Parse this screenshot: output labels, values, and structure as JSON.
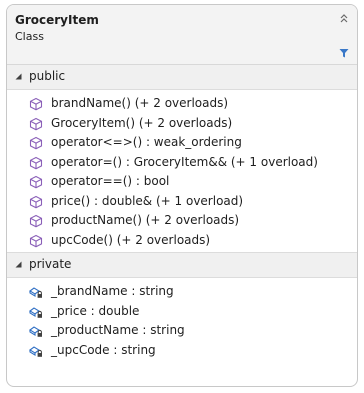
{
  "header": {
    "class_name": "GroceryItem",
    "stereotype": "Class"
  },
  "icons": {
    "collapse": "double-chevron-up-icon",
    "filter": "filter-icon",
    "section_toggle": "triangle-down-icon",
    "method": "method-cube-icon",
    "field": "private-field-icon"
  },
  "colors": {
    "method_icon": "#8a5fb8",
    "field_icon": "#2f6fc4",
    "lock": "#404040"
  },
  "sections": {
    "public": {
      "label": "public",
      "members": [
        "brandName() (+ 2 overloads)",
        "GroceryItem() (+ 2 overloads)",
        "operator<=>() : weak_ordering",
        "operator=() : GroceryItem&& (+ 1 overload)",
        "operator==() : bool",
        "price() : double& (+ 1 overload)",
        "productName() (+ 2 overloads)",
        "upcCode() (+ 2 overloads)"
      ]
    },
    "private": {
      "label": "private",
      "members": [
        "_brandName : string",
        "_price : double",
        "_productName : string",
        "_upcCode : string"
      ]
    }
  }
}
